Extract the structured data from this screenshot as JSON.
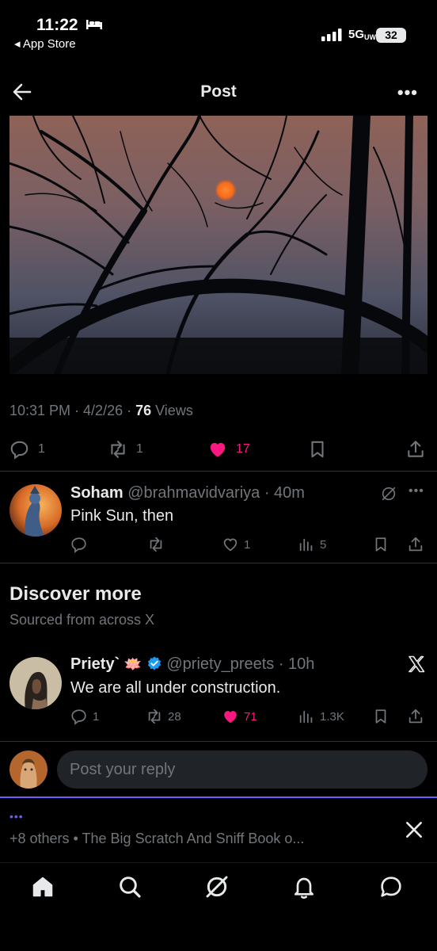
{
  "status_bar": {
    "time": "11:22",
    "back_app": "◂ App Store",
    "network": "5G",
    "network_suffix": "UW",
    "battery": "32"
  },
  "header": {
    "title": "Post",
    "more": "•••"
  },
  "post": {
    "timestamp": "10:31 PM · 4/2/26 · ",
    "views_count": "76",
    "views_label": " Views",
    "replies": "1",
    "reposts": "1",
    "likes": "17",
    "liked_color": "#f91880"
  },
  "reply": {
    "name": "Soham",
    "handle": "@brahmavidvariya",
    "time": " · 40m",
    "text": "Pink Sun, then",
    "likes": "1",
    "views": "5"
  },
  "discover": {
    "title": "Discover more",
    "subtitle": "Sourced from across X"
  },
  "suggested": {
    "name": "Priety`",
    "emoji": "🪷",
    "handle": "@priety_preets",
    "time": " · 10h",
    "text": "We are all under construction.",
    "replies": "1",
    "reposts": "28",
    "likes": "71",
    "views": "1.3K"
  },
  "composer": {
    "placeholder": "Post your reply"
  },
  "notice": {
    "dots": "•••",
    "text": "+8 others • The Big Scratch And Sniff Book o..."
  },
  "colors": {
    "accent": "#7856ff",
    "like": "#f91880",
    "verified": "#1d9bf0"
  }
}
